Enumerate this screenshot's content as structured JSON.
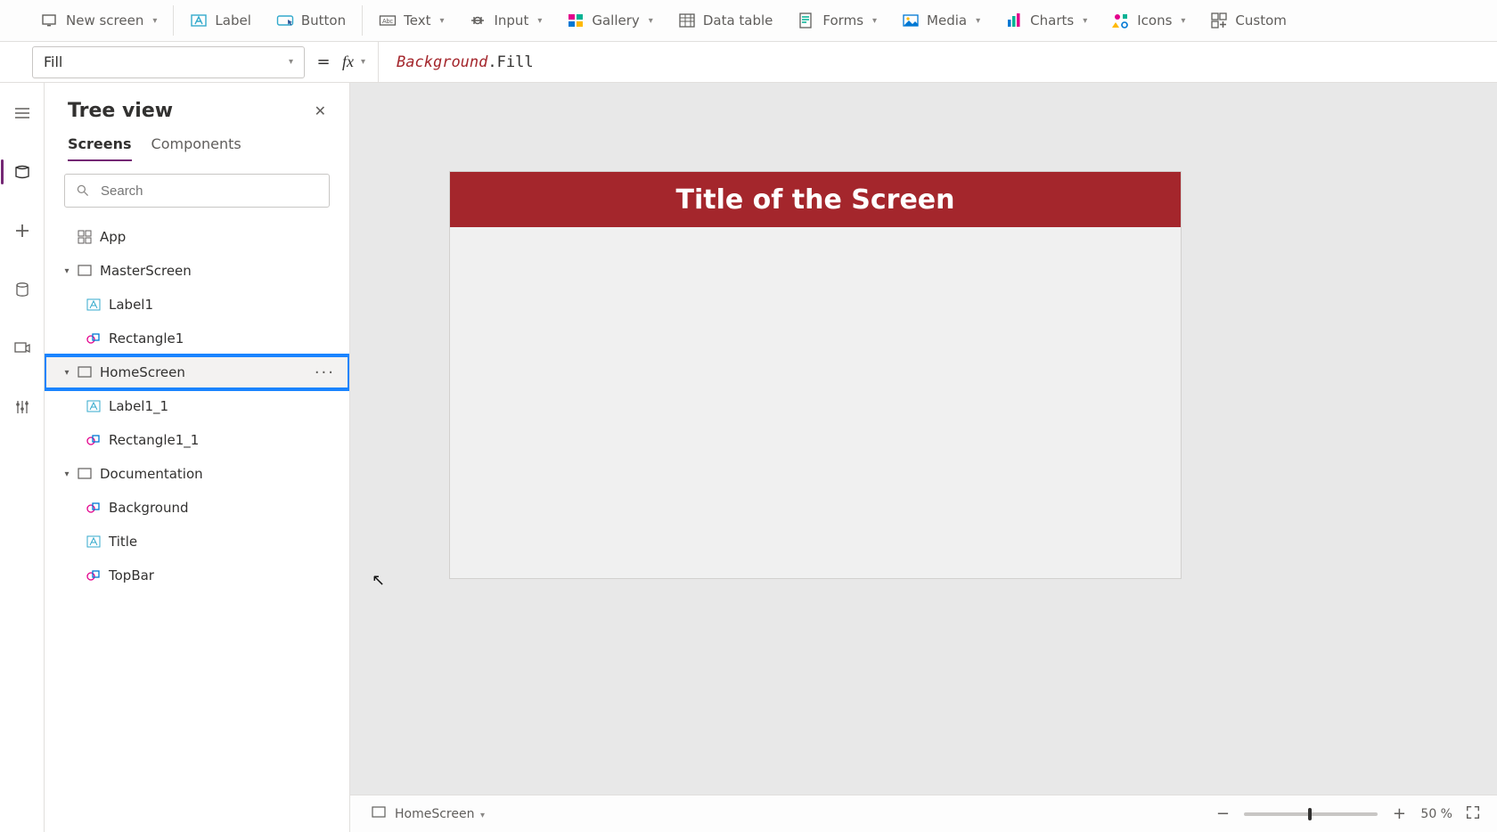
{
  "ribbon": {
    "new_screen": "New screen",
    "label": "Label",
    "button": "Button",
    "text": "Text",
    "input": "Input",
    "gallery": "Gallery",
    "data_table": "Data table",
    "forms": "Forms",
    "media": "Media",
    "charts": "Charts",
    "icons": "Icons",
    "custom": "Custom"
  },
  "formula": {
    "property": "Fill",
    "token_ident": "Background",
    "token_dot": ".",
    "token_prop": "Fill"
  },
  "pane": {
    "title": "Tree view",
    "tabs": {
      "screens": "Screens",
      "components": "Components"
    },
    "search_placeholder": "Search"
  },
  "tree": {
    "app": "App",
    "master": "MasterScreen",
    "master_children": {
      "label1": "Label1",
      "rect1": "Rectangle1"
    },
    "home": "HomeScreen",
    "home_children": {
      "label1_1": "Label1_1",
      "rect1_1": "Rectangle1_1"
    },
    "doc": "Documentation",
    "doc_children": {
      "bg": "Background",
      "title": "Title",
      "topbar": "TopBar"
    }
  },
  "canvas": {
    "header_title": "Title of the Screen"
  },
  "status": {
    "screen": "HomeScreen",
    "zoom_pct": "50 %"
  }
}
